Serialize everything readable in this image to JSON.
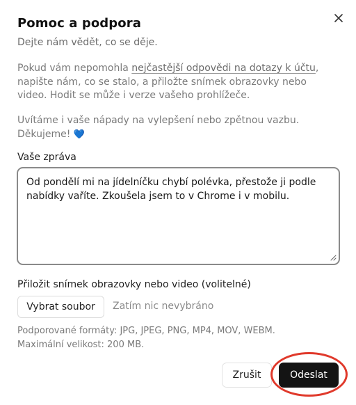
{
  "dialog": {
    "title": "Pomoc a podpora",
    "subtitle": "Dejte nám vědět, co se děje.",
    "close_icon": "close-icon",
    "intro": {
      "before_link": "Pokud vám nepomohla ",
      "link_text": "nejčastější odpovědi na dotazy k účtu",
      "after_link": ", napište nám, co se stalo, a přiložte snímek obrazovky nebo video. Hodit se může i verze vašeho prohlížeče."
    },
    "feedback": {
      "text": "Uvítáme i vaše nápady na vylepšení nebo zpětnou vazbu. Děkujeme! ",
      "heart": "💙"
    },
    "message": {
      "label": "Vaše zpráva",
      "value": "Od pondělí mi na jídelníčku chybí polévka, přestože ji podle nabídky vaříte. Zkoušela jsem to v Chrome i v mobilu."
    },
    "attachment": {
      "label": "Přiložit snímek obrazovky nebo video (volitelné)",
      "button_label": "Vybrat soubor",
      "status": "Zatím nic nevybráno",
      "formats": "Podporované formáty: JPG, JPEG, PNG, MP4, MOV, WEBM.",
      "max_size": "Maximální velikost: 200 MB."
    },
    "actions": {
      "cancel_label": "Zrušit",
      "submit_label": "Odeslat"
    },
    "colors": {
      "primary_button": "#141414",
      "highlight": "#e0392b",
      "heart": "#2f7ed8"
    }
  }
}
